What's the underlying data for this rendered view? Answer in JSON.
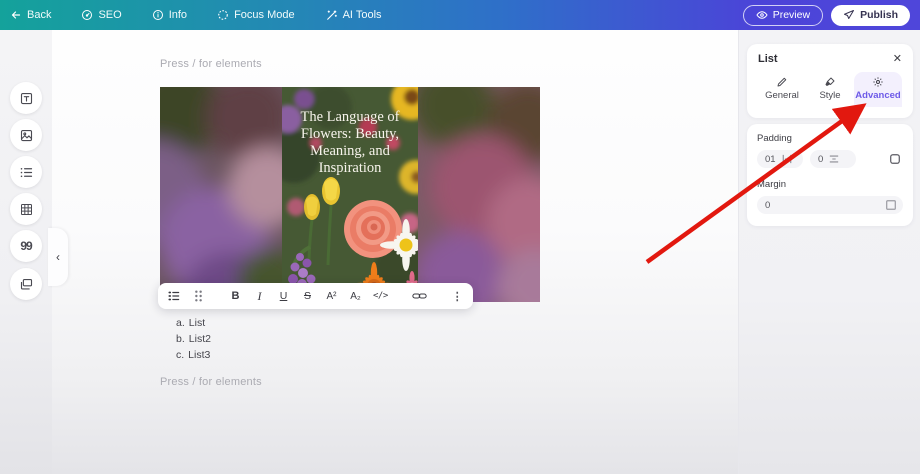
{
  "topbar": {
    "back_label": "Back",
    "seo_label": "SEO",
    "info_label": "Info",
    "focus_label": "Focus Mode",
    "ai_label": "AI Tools",
    "preview_label": "Preview",
    "publish_label": "Publish"
  },
  "sidebar": {
    "tools": [
      "text-block",
      "image",
      "list",
      "table",
      "quote",
      "media"
    ],
    "quote_glyph": "99",
    "collapse_glyph": "‹"
  },
  "editor": {
    "placeholder_top": "Press / for elements",
    "placeholder_bottom": "Press / for elements",
    "cover_image": {
      "title_lines": [
        "The Language of",
        "Flowers: Beauty,",
        "Meaning, and",
        "Inspiration"
      ]
    },
    "toolbar": {
      "bold": "B",
      "italic": "I",
      "underline": "U",
      "strikethrough": "S",
      "superscript": "A²",
      "subscript": "A₂",
      "code": "</>",
      "more": "⋮"
    },
    "list": {
      "items": [
        {
          "marker": "a.",
          "label": "List"
        },
        {
          "marker": "b.",
          "label": "List2"
        },
        {
          "marker": "c.",
          "label": "List3"
        }
      ]
    }
  },
  "panel": {
    "title": "List",
    "close_glyph": "✕",
    "tabs": [
      {
        "label": "General",
        "active": false
      },
      {
        "label": "Style",
        "active": false
      },
      {
        "label": "Advanced",
        "active": true
      }
    ],
    "padding": {
      "label": "Padding",
      "horizontal_value": "01",
      "vertical_value": "0"
    },
    "margin": {
      "label": "Margin",
      "value": "0"
    }
  },
  "colors": {
    "topbar_teal": "#14a29b",
    "topbar_indigo": "#4b44d8",
    "accent_purple": "#6d5ae8",
    "arrow_red": "#e2180f",
    "placeholder_gray": "#ababb2"
  }
}
